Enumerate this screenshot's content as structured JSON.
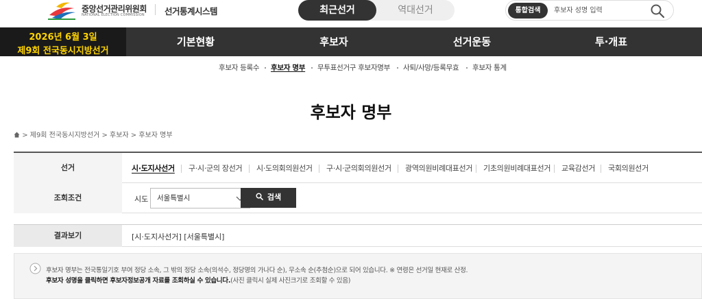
{
  "header": {
    "org_name": "중앙선거관리위원회",
    "org_sub": "NATIONAL ELECTION COMMISSION",
    "system_title": "선거통계시스템",
    "toggle": {
      "active": "최근선거",
      "inactive": "역대선거"
    },
    "search": {
      "badge": "통합검색",
      "placeholder": "후보자 성명 입력"
    }
  },
  "nav": {
    "event_date": "2026년 6월 3일",
    "event_name": "제9회 전국동시지방선거",
    "menus": [
      "기본현황",
      "후보자",
      "선거운동",
      "투·개표"
    ]
  },
  "subnav": {
    "items": [
      "후보자 등록수",
      "후보자 명부",
      "무투표선거구 후보자명부",
      "사퇴/사망/등록무효",
      "후보자 통계"
    ],
    "active_index": 1
  },
  "page_title": "후보자 명부",
  "breadcrumb": "> 제9회 전국동시지방선거 > 후보자 > 후보자 명부",
  "filter": {
    "election_label": "선거",
    "election_tabs": [
      "시·도지사선거",
      "구·시·군의 장선거",
      "시·도의회의원선거",
      "구·시·군의회의원선거",
      "광역의원비례대표선거",
      "기초의원비례대표선거",
      "교육감선거",
      "국회의원선거"
    ],
    "active_tab": 0,
    "condition_label": "조회조건",
    "sido_label": "시도",
    "sido_value": "서울특별시",
    "search_button": "검색"
  },
  "result": {
    "label": "결과보기",
    "value": "[시·도지사선거] [서울특별시]"
  },
  "notice": {
    "line1": "후보자 명부는 전국통일기호 부여 정당 소속, 그 밖의 정당 소속(의석수, 정당명의 가나다 순), 무소속 순(추첨순)으로 되어 있습니다. ※ 연령은 선거일 현재로 산정.",
    "line2_bold": "후보자 성명을 클릭하면 후보자정보공개 자료를 조회하실 수 있습니다.",
    "line2_rest": "(사진 클릭시 실제 사진크기로 조회할 수 있음)"
  },
  "colors": {
    "nav_bg": "#333333",
    "event_bg": "#1a1a1a",
    "event_text": "#ffd400",
    "dark_button": "#333333"
  }
}
